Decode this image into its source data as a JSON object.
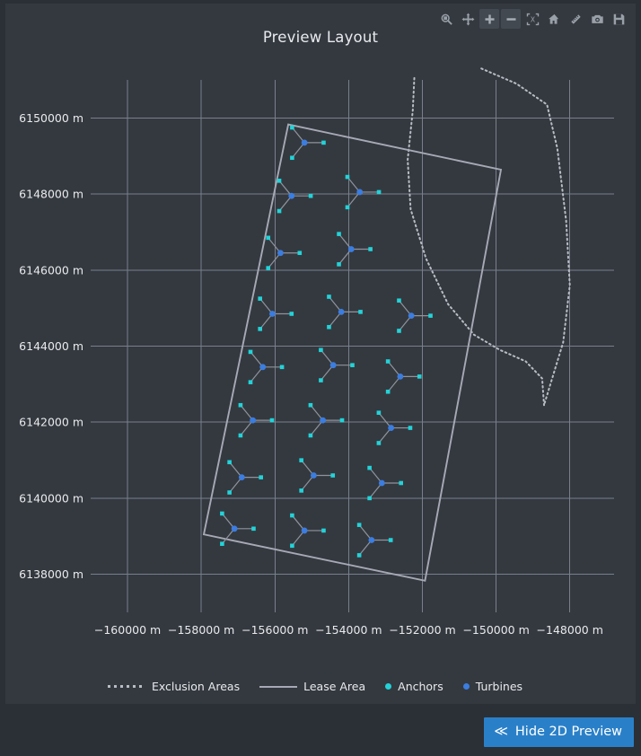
{
  "panel": {
    "title": "Preview Layout"
  },
  "toolbar": {
    "buttons": [
      {
        "name": "zoom-icon",
        "label": "Zoom",
        "boxed": false
      },
      {
        "name": "pan-icon",
        "label": "Pan",
        "boxed": false
      },
      {
        "name": "zoom-in-icon",
        "label": "Zoom In",
        "boxed": true
      },
      {
        "name": "zoom-out-icon",
        "label": "Zoom Out",
        "boxed": true
      },
      {
        "name": "fit-extent-icon",
        "label": "Zoom To Fit",
        "boxed": false
      },
      {
        "name": "home-icon",
        "label": "Home",
        "boxed": false
      },
      {
        "name": "measure-icon",
        "label": "Measure",
        "boxed": false
      },
      {
        "name": "camera-icon",
        "label": "Screenshot",
        "boxed": false
      },
      {
        "name": "save-icon",
        "label": "Save",
        "boxed": false
      }
    ]
  },
  "legend": {
    "items": [
      {
        "label": "Exclusion Areas",
        "marker": "dotted-line",
        "color": "#b9bcc4"
      },
      {
        "label": "Lease Area",
        "marker": "solid-line",
        "color": "#a7a9b4"
      },
      {
        "label": "Anchors",
        "marker": "dot",
        "color": "#22d3d8"
      },
      {
        "label": "Turbines",
        "marker": "dot",
        "color": "#3b7de0"
      }
    ]
  },
  "footer": {
    "hide_preview_label": "Hide 2D Preview",
    "chevron": "≪",
    "accent_color": "#2a80c8"
  },
  "chart_data": {
    "type": "scatter",
    "title": "Preview Layout",
    "xlabel": "",
    "ylabel": "",
    "grid": true,
    "legend_position": "bottom",
    "xlim": [
      -161000,
      -146800
    ],
    "ylim": [
      6137000,
      6151000
    ],
    "xticks": [
      -160000,
      -158000,
      -156000,
      -154000,
      -152000,
      -150000,
      -148000
    ],
    "yticks": [
      6138000,
      6140000,
      6142000,
      6144000,
      6146000,
      6148000,
      6150000
    ],
    "xticklabels": [
      "−160000 m",
      "−158000 m",
      "−156000 m",
      "−154000 m",
      "−152000 m",
      "−150000 m",
      "−148000 m"
    ],
    "yticklabels": [
      "6138000 m",
      "6140000 m",
      "6142000 m",
      "6144000 m",
      "6146000 m",
      "6148000 m",
      "6150000 m"
    ],
    "series": [
      {
        "name": "Lease Area",
        "type": "polygon",
        "color": "#a7a9b4",
        "points": [
          [
            -155640,
            6149830
          ],
          [
            -149870,
            6148640
          ],
          [
            -151930,
            6137830
          ],
          [
            -157930,
            6139050
          ]
        ]
      },
      {
        "name": "Exclusion Areas",
        "type": "dotted-polylines",
        "color": "#b9bcc4",
        "paths": [
          [
            [
              -152220,
              6151050
            ],
            [
              -152260,
              6150200
            ],
            [
              -152400,
              6148900
            ],
            [
              -152320,
              6147600
            ],
            [
              -151900,
              6146300
            ],
            [
              -151300,
              6145100
            ],
            [
              -150600,
              6144300
            ],
            [
              -149900,
              6143900
            ],
            [
              -149200,
              6143600
            ],
            [
              -148750,
              6143150
            ],
            [
              -148700,
              6142450
            ]
          ],
          [
            [
              -150400,
              6151300
            ],
            [
              -149450,
              6150900
            ],
            [
              -148620,
              6150350
            ],
            [
              -148340,
              6149200
            ],
            [
              -148100,
              6147300
            ],
            [
              -148000,
              6145600
            ],
            [
              -148180,
              6144100
            ],
            [
              -148700,
              6142450
            ]
          ]
        ]
      },
      {
        "name": "Turbines",
        "type": "points",
        "color": "#3b7de0",
        "anchor_color": "#22d3d8",
        "anchor_radius_m": 520,
        "anchor_bearings_deg": [
          0,
          130,
          230
        ],
        "points": [
          [
            -155200,
            6149350
          ],
          [
            -155550,
            6147950
          ],
          [
            -155850,
            6146450
          ],
          [
            -156070,
            6144850
          ],
          [
            -156330,
            6143450
          ],
          [
            -156600,
            6142050
          ],
          [
            -156900,
            6140550
          ],
          [
            -157100,
            6139200
          ],
          [
            -153700,
            6148050
          ],
          [
            -153930,
            6146550
          ],
          [
            -154200,
            6144900
          ],
          [
            -154420,
            6143500
          ],
          [
            -154700,
            6142050
          ],
          [
            -154950,
            6140600
          ],
          [
            -155200,
            6139150
          ],
          [
            -152300,
            6144800
          ],
          [
            -152600,
            6143200
          ],
          [
            -152850,
            6141850
          ],
          [
            -153100,
            6140400
          ],
          [
            -153380,
            6138900
          ]
        ]
      }
    ]
  }
}
